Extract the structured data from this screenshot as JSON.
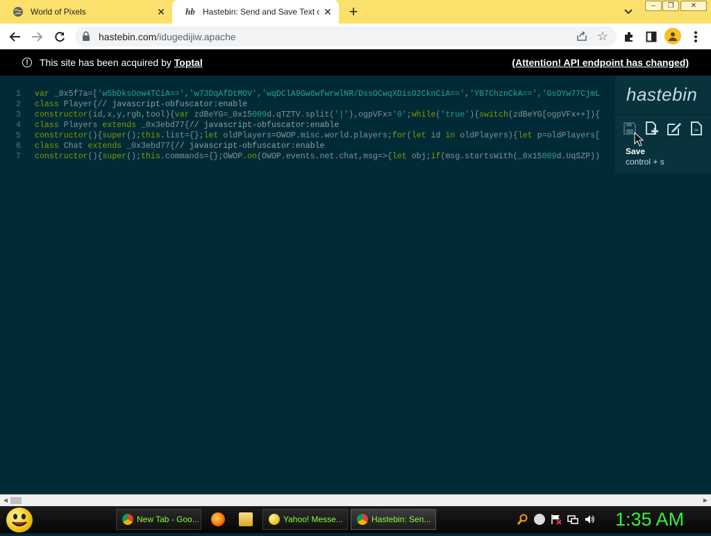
{
  "browser": {
    "tabs": [
      {
        "title": "World of Pixels",
        "active": false
      },
      {
        "title": "Hastebin: Send and Save Text or Code Snippets for Free | Toptal",
        "favicon_text": "hb",
        "active": true
      }
    ],
    "url_host": "hastebin.com",
    "url_path": "/idugedijiw.apache",
    "window_controls": [
      "minimize",
      "restore",
      "close"
    ]
  },
  "banner": {
    "message": "This site has been acquired by",
    "link": "Toptal",
    "attention": "(Attention! API endpoint has changed)"
  },
  "editor": {
    "lines": [
      {
        "num": "1",
        "html": "<span class=\"kw\">var</span> _0x5f7a=[<span class=\"str\">'w5bDksOow4TCiA=='</span>,<span class=\"str\">'w73DqAfDtMOV'</span>,<span class=\"str\">'wqDClA9Gw6wfwrwlNR/DssOCwqXDisO2CknCiA=='</span>,<span class=\"str\">'YB7ChznCkA=='</span>,<span class=\"str\">'GsOYw77CjmL</span>"
      },
      {
        "num": "2",
        "html": "<span class=\"kw\">class</span> Player{<span class=\"cm\">// javascript-obfuscator:enable</span>"
      },
      {
        "num": "3",
        "html": "<span class=\"kw\">constructor</span>(id,x,y,rgb,tool){<span class=\"kw\">var</span> zdBeYG=_0x15<span class=\"num\">009</span>d.qTZTV.split(<span class=\"str\">'|'</span>),ogpVFx=<span class=\"str\">'0'</span>;<span class=\"kw\">while</span>(<span class=\"str\">'true'</span>){<span class=\"kw\">switch</span>(zdBeYG[ogpVFx++]){"
      },
      {
        "num": "4",
        "html": "<span class=\"kw\">class</span> Players <span class=\"kw\">extends</span> _0x3ebd77{<span class=\"cm\">// javascript-obfuscator:enable</span>"
      },
      {
        "num": "5",
        "html": "<span class=\"kw\">constructor</span>(){<span class=\"kw\">super</span>();<span class=\"kw\">this</span>.list={};<span class=\"kw\">let</span> oldPlayers=OWOP.misc.world.players;<span class=\"kw\">for</span>(<span class=\"kw\">let</span> id <span class=\"kw\">in</span> oldPlayers){<span class=\"kw\">let</span> p=oldPlayers["
      },
      {
        "num": "6",
        "html": "<span class=\"kw\">class</span> Chat <span class=\"kw\">extends</span> _0x3ebd77{<span class=\"cm\">// javascript-obfuscator:enable</span>"
      },
      {
        "num": "7",
        "html": "<span class=\"kw\">constructor</span>(){<span class=\"kw\">super</span>();<span class=\"kw\">this</span>.commands={};OWOP.<span class=\"kw\">on</span>(OWOP.events.net.chat,msg=>{<span class=\"kw\">let</span> obj;<span class=\"kw\">if</span>(msg.startsWith(_0x15<span class=\"num\">009</span>d.UqSZP))"
      }
    ]
  },
  "hastebin": {
    "logo": "hastebin",
    "buttons": [
      "save-icon",
      "new-document-icon",
      "edit-icon",
      "raw-text-icon"
    ],
    "tooltip_name": "Save",
    "tooltip_shortcut": "control + s"
  },
  "taskbar": {
    "tasks": [
      {
        "label": "New Tab - Goo...",
        "icon": "chrome-icon"
      },
      {
        "label": "Yahoo! Messe...",
        "icon": "yahoo-messenger-icon"
      },
      {
        "label": "Hastebin: Sen...",
        "icon": "chrome-icon"
      }
    ],
    "quicklaunch": [
      "firefox-icon",
      "folder-icon"
    ],
    "tray": [
      "search-icon",
      "messenger-status-icon",
      "flag-icon",
      "network-icon",
      "volume-icon"
    ],
    "clock": "1:35 AM"
  },
  "colors": {
    "background": "#002b36",
    "tabstrip": "#fbe16b",
    "clock": "#36f13a"
  }
}
